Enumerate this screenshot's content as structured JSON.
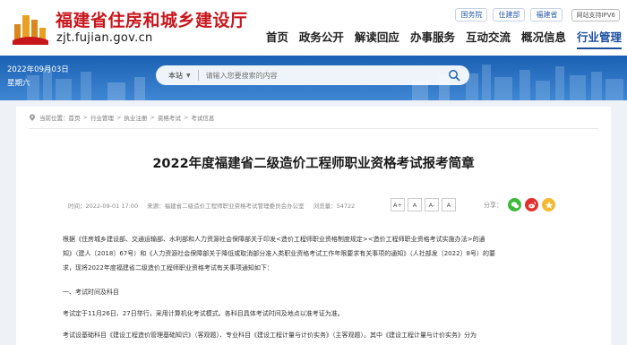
{
  "header": {
    "logo_text": "福建省住房和城乡建设厅",
    "logo_url": "zjt.fujian.gov.cn",
    "top_links": [
      "国务院",
      "住建部",
      "福建省"
    ],
    "ipv6_label": "网站支持IPV6",
    "nav": [
      "首页",
      "政务公开",
      "解读回应",
      "办事服务",
      "互动交流",
      "概况信息",
      "行业管理"
    ],
    "active_nav": "行业管理"
  },
  "banner": {
    "date": "2022年09月03日",
    "weekday": "星期六",
    "search_scope": "本站",
    "search_placeholder": "请输入您要搜索的内容"
  },
  "breadcrumb": {
    "label": "当前位置：",
    "items": [
      "首页",
      "行业管理",
      "执业注册",
      "资格考试",
      "考试信息"
    ]
  },
  "article": {
    "title": "2022年度福建省二级造价工程师职业资格考试报考简章",
    "time": "时间：2022-09-01 17:00",
    "source": "来源：福建省二级造价工程师职业资格考试管理委员会办公室",
    "views": "浏览量：54722",
    "font_buttons": [
      "A+",
      "A",
      "A-",
      "A"
    ],
    "share_label": "分享：",
    "para1_line1": "根据《住房城乡建设部、交通运输部、水利部和人力资源社会保障部关于印发<造价工程师职业资格制度规定><造价工程师职业资格考试实施办法>的通",
    "para1_line2": "知》（建人〔2018〕67号）和《人力资源社会保障部关于降低或取消部分准入类职业资格考试工作年限要求有关事项的通知》（人社部发〔2022〕8号）的要",
    "para1_line3": "求，现将2022年度福建省二级造价工程师职业资格考试有关事项通知如下：",
    "section1": "一、考试时间及科目",
    "para2": "考试定于11月26日、27日举行，采用计算机化考试模式。各科目具体考试时间及地点以准考证为准。",
    "para3": "考试设基础科目《建设工程造价管理基础知识》（客观题）、专业科目《建设工程计量与计价实务》（主客观题）。其中《建设工程计量与计价实务》分为"
  },
  "colors": {
    "logo_red": "#c8161d",
    "nav_active": "#1a4e9e",
    "banner_blue": "#2a72c4",
    "wechat": "#3db93a",
    "weibo": "#e0312e",
    "qzone": "#f5b82e"
  }
}
